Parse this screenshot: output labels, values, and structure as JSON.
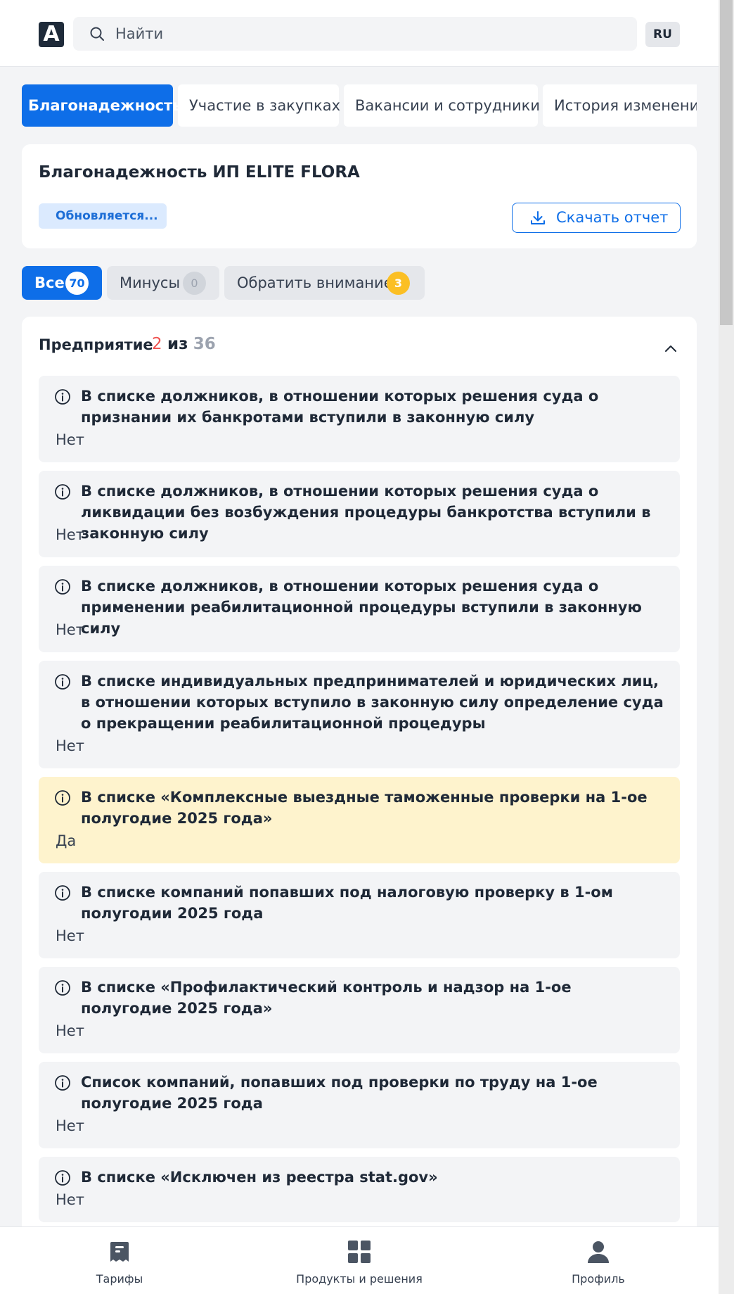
{
  "header": {
    "logo_letter": "A",
    "search_placeholder": "Найти",
    "lang": "RU"
  },
  "tabs": [
    {
      "label": "Благонадежность",
      "active": true
    },
    {
      "label": "Участие в закупках"
    },
    {
      "label": "Вакансии и сотрудники"
    },
    {
      "label": "История изменений"
    }
  ],
  "report": {
    "title": "Благонадежность ИП ELITE FLORA",
    "status": "Обновляется...",
    "download_label": "Скачать отчет"
  },
  "filters": [
    {
      "label": "Все",
      "count": "70",
      "active": true
    },
    {
      "label": "Минусы",
      "count": "0"
    },
    {
      "label": "Обратить внимание",
      "count": "3"
    }
  ],
  "section": {
    "title": "Предприятие",
    "count_highlight": "2",
    "count_of": "из",
    "count_total": "36"
  },
  "items": [
    {
      "title": "В списке должников, в отношении которых решения суда о признании их банкротами вступили в законную силу",
      "value": "Нет"
    },
    {
      "title": "В списке должников, в отношении которых решения суда о ликвидации без возбуждения процедуры банкротства вступили в законную силу",
      "value": "Нет"
    },
    {
      "title": "В списке должников, в отношении которых решения суда о применении реабилитационной процедуры вступили в законную силу",
      "value": "Нет"
    },
    {
      "title": "В списке индивидуальных предпринимателей и юридических лиц, в отношении которых вступило в законную силу определение суда о прекращении реабилитационной процедуры",
      "value": "Нет"
    },
    {
      "title": "В списке «Комплексные выездные таможенные проверки на 1-ое полугодие 2025 года»",
      "value": "Да",
      "warning": true
    },
    {
      "title": "В списке компаний попавших под налоговую проверку в 1-ом полугодии 2025 года",
      "value": "Нет"
    },
    {
      "title": "В списке «Профилактический контроль и надзор на 1-ое полугодие 2025 года»",
      "value": "Нет"
    },
    {
      "title": "Список компаний, попавших под проверки по труду на 1-ое полугодие 2025 года",
      "value": "Нет"
    },
    {
      "title": "В списке «Исключен из реестра stat.gov»",
      "value": "Нет"
    }
  ],
  "bottom_nav": [
    {
      "label": "Тарифы",
      "icon": "tariffs-icon"
    },
    {
      "label": "Продукты и решения",
      "icon": "grid-icon"
    },
    {
      "label": "Профиль",
      "icon": "profile-icon"
    }
  ],
  "colors": {
    "accent": "#0e6ee8",
    "warning_bg": "#fef3cd",
    "badge_yellow": "#fbbf24",
    "count_red": "#ef5350"
  }
}
